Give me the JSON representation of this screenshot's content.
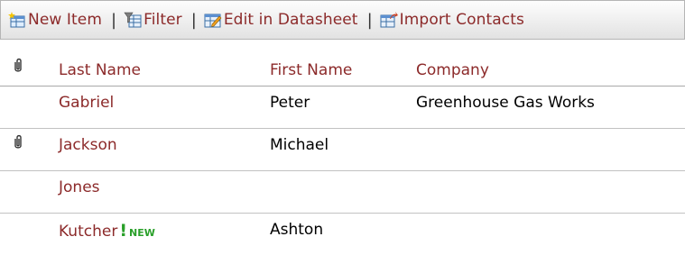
{
  "toolbar": {
    "items": [
      {
        "label": "New Item",
        "icon": "new-item-icon"
      },
      {
        "label": "Filter",
        "icon": "filter-icon"
      },
      {
        "label": "Edit in Datasheet",
        "icon": "datasheet-icon"
      },
      {
        "label": "Import Contacts",
        "icon": "import-icon"
      }
    ],
    "separator": "|"
  },
  "list": {
    "columns": {
      "attachment_icon": "paperclip-icon",
      "last_name": "Last Name",
      "first_name": "First Name",
      "company": "Company"
    },
    "rows": [
      {
        "last_name": "Gabriel",
        "first_name": "Peter",
        "company": "Greenhouse Gas Works",
        "has_attachment": false,
        "is_new": false
      },
      {
        "last_name": "Jackson",
        "first_name": "Michael",
        "company": "",
        "has_attachment": true,
        "is_new": false
      },
      {
        "last_name": "Jones",
        "first_name": "",
        "company": "",
        "has_attachment": false,
        "is_new": false
      },
      {
        "last_name": "Kutcher",
        "first_name": "Ashton",
        "company": "",
        "has_attachment": false,
        "is_new": true,
        "new_label": "NEW",
        "new_mark": "!"
      }
    ]
  },
  "colors": {
    "link": "#8c2a2a",
    "new_badge": "#2aa02a",
    "header_border": "#a9a9a9"
  }
}
